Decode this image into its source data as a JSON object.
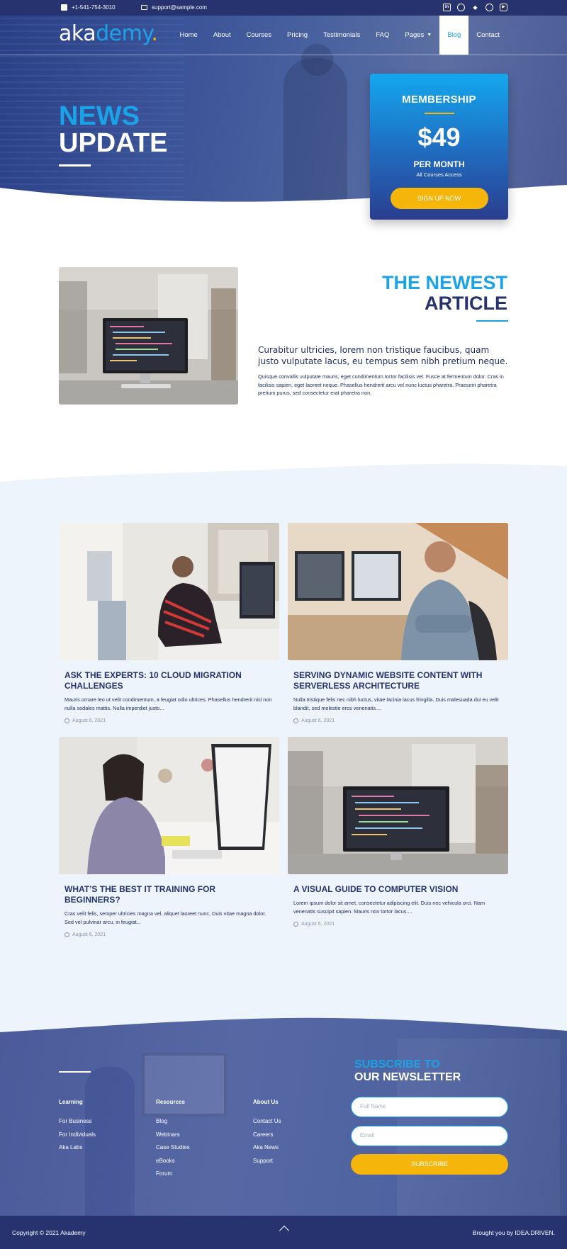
{
  "topbar": {
    "phone": "+1-541-754-3010",
    "email": "support@sample.com",
    "social_icons": [
      "linkedin-icon",
      "facebook-icon",
      "twitter-icon",
      "skype-icon",
      "youtube-icon"
    ]
  },
  "logo": {
    "part1": "aka",
    "part2": "demy",
    "dot": "."
  },
  "nav": {
    "items": [
      "Home",
      "About",
      "Courses",
      "Pricing",
      "Testimonials",
      "FAQ",
      "Pages",
      "Blog",
      "Contact"
    ],
    "active": "Blog"
  },
  "hero": {
    "line1": "NEWS",
    "line2": "UPDATE"
  },
  "membership": {
    "title": "MEMBERSHIP",
    "price": "$49",
    "period": "PER MONTH",
    "note": "All Courses Access",
    "button": "SIGN UP NOW"
  },
  "newest": {
    "line1": "THE NEWEST",
    "line2": "ARTICLE",
    "lead": "Curabitur ultricies, lorem non tristique faucibus, quam justo vulputate lacus, eu tempus sem nibh pretium neque.",
    "body": "Quisque convallis vulputate mauris, eget condimentum tortor facilisis vel. Fusce at fermentum dolor. Cras in facilisis sapien, eget laoreet neque. Phasellus hendrerit arcu vel nunc luctus pharetra. Praesent pharetra pretium purus, sed consectetur erat pharetra non."
  },
  "posts": [
    {
      "title": "ASK THE EXPERTS: 10 CLOUD MIGRATION CHALLENGES",
      "excerpt": "Mauris ornare leo ut velit condimentum, a feugiat odio ultrices. Phasellus hendrerit nisl non nulla sodales mattis. Nulla imperdiet justo...",
      "date": "August 6, 2021"
    },
    {
      "title": "SERVING DYNAMIC WEBSITE CONTENT WITH SERVERLESS ARCHITECTURE",
      "excerpt": "Nulla tristique felis nec nibh luctus, vitae lacinia lacus fringilla. Duis malesuada dui eu velit blandit, sed molestie eros venenatis....",
      "date": "August 6, 2021"
    },
    {
      "title": "WHAT’S THE BEST IT TRAINING FOR BEGINNERS?",
      "excerpt": "Cras velit felis, semper ultricies magna vel, aliquet laoreet nunc. Duis vitae magna dolor. Sed vel pulvinar arcu, in feugiat...",
      "date": "August 6, 2021"
    },
    {
      "title": "A VISUAL GUIDE TO COMPUTER VISION",
      "excerpt": "Lorem ipsum dolor sit amet, consectetur adipiscing elit. Duis nec vehicula orci. Nam venenatis suscipit sapien. Mauris non tortor lacus....",
      "date": "August 6, 2021"
    }
  ],
  "footer": {
    "columns": [
      {
        "heading": "Learning",
        "links": [
          "For Business",
          "For Individuals",
          "Aka Labs"
        ]
      },
      {
        "heading": "Resources",
        "links": [
          "Blog",
          "Webinars",
          "Case Studies",
          "eBooks",
          "Forum"
        ]
      },
      {
        "heading": "About Us",
        "links": [
          "Contact Us",
          "Careers",
          "Aka News",
          "Support"
        ]
      }
    ],
    "newsletter": {
      "line1": "SUBSCRIBE TO",
      "line2": "OUR NEWSLETTER",
      "name_placeholder": "Full Name",
      "email_placeholder": "Email",
      "button": "SUBSCRIBE"
    },
    "copyright": "Copyright © 2021 Akademy",
    "credit": "Brought you by IDEA.DRIVEN."
  },
  "colors": {
    "navy": "#27336f",
    "accent": "#1aa3e8",
    "yellow": "#f5b50a",
    "light_bg": "#edf4fc"
  }
}
